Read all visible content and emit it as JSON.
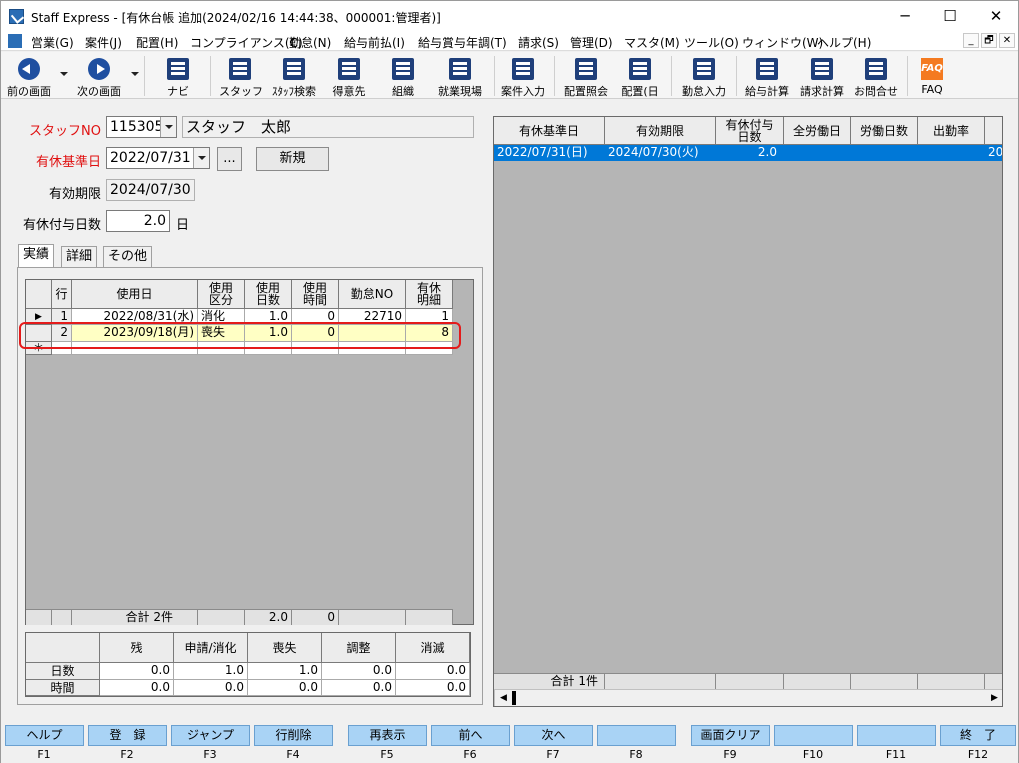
{
  "window": {
    "title": "Staff Express - [有休台帳 追加(2024/02/16 14:44:38、000001:管理者)]",
    "min": "─",
    "max": "☐",
    "close": "✕"
  },
  "menu": [
    "営業(G)",
    "案件(J)",
    "配置(H)",
    "コンプライアンス(C)",
    "勤怠(N)",
    "給与前払(I)",
    "給与賞与年調(T)",
    "請求(S)",
    "管理(D)",
    "マスタ(M)",
    "ツール(O)",
    "ウィンドウ(W)",
    "ヘルプ(H)"
  ],
  "mdi_buttons": [
    "_",
    "🗗",
    "✕"
  ],
  "toolbar": [
    "前の画面",
    "次の画面",
    "ナビ",
    "スタッフ",
    "ｽﾀｯﾌ検索",
    "得意先",
    "組織",
    "就業現場",
    "案件入力",
    "配置照会",
    "配置(日",
    "勤怠入力",
    "給与計算",
    "請求計算",
    "お問合せ",
    "FAQ"
  ],
  "faq_icon": "FAQ",
  "form": {
    "staff_no_label": "スタッフNO",
    "staff_no": "115305",
    "staff_name": "スタッフ　太郎",
    "base_date_label": "有休基準日",
    "base_date": "2022/07/31",
    "ellipsis": "...",
    "new_button": "新規",
    "expiry_label": "有効期限",
    "expiry": "2024/07/30",
    "days_label": "有休付与日数",
    "days": "2.0",
    "days_unit": "日"
  },
  "tabs": [
    "実績",
    "詳細",
    "その他"
  ],
  "usage_grid": {
    "headers": [
      "行",
      "使用日",
      "使用\n区分",
      "使用\n日数",
      "使用\n時間",
      "勤怠NO",
      "有休\n明細"
    ],
    "rows": [
      [
        "1",
        "2022/08/31(水)",
        "消化",
        "1.0",
        "0",
        "22710",
        "1"
      ],
      [
        "2",
        "2023/09/18(月)",
        "喪失",
        "1.0",
        "0",
        "",
        "8"
      ]
    ],
    "row_marker": "▶",
    "new_marker": "＊",
    "total_label": "合計 2件",
    "total_days": "2.0",
    "total_hours": "0"
  },
  "summary": {
    "headers": [
      "残",
      "申請/消化",
      "喪失",
      "調整",
      "消滅"
    ],
    "rows": [
      {
        "label": "日数",
        "values": [
          "0.0",
          "1.0",
          "1.0",
          "0.0",
          "0.0"
        ]
      },
      {
        "label": "時間",
        "values": [
          "0.0",
          "0.0",
          "0.0",
          "0.0",
          "0.0"
        ]
      }
    ]
  },
  "right_grid": {
    "headers": [
      "有休基準日",
      "有効期限",
      "有休付与\n日数",
      "全労働日",
      "労働日数",
      "出勤率"
    ],
    "rows": [
      [
        "2022/07/31(日)",
        "2024/07/30(火)",
        "2.0",
        "",
        "",
        "",
        "20"
      ]
    ],
    "total_label": "合計 1件",
    "scroll_left": "◀",
    "scroll_right": "▶"
  },
  "fkeys": [
    {
      "label": "ヘルプ",
      "key": "F1"
    },
    {
      "label": "登　録",
      "key": "F2"
    },
    {
      "label": "ジャンプ",
      "key": "F3"
    },
    {
      "label": "行削除",
      "key": "F4"
    },
    {
      "label": "再表示",
      "key": "F5"
    },
    {
      "label": "前へ",
      "key": "F6"
    },
    {
      "label": "次へ",
      "key": "F7"
    },
    {
      "label": "",
      "key": "F8"
    },
    {
      "label": "画面クリア",
      "key": "F9"
    },
    {
      "label": "",
      "key": "F10"
    },
    {
      "label": "",
      "key": "F11"
    },
    {
      "label": "終　了",
      "key": "F12"
    }
  ]
}
